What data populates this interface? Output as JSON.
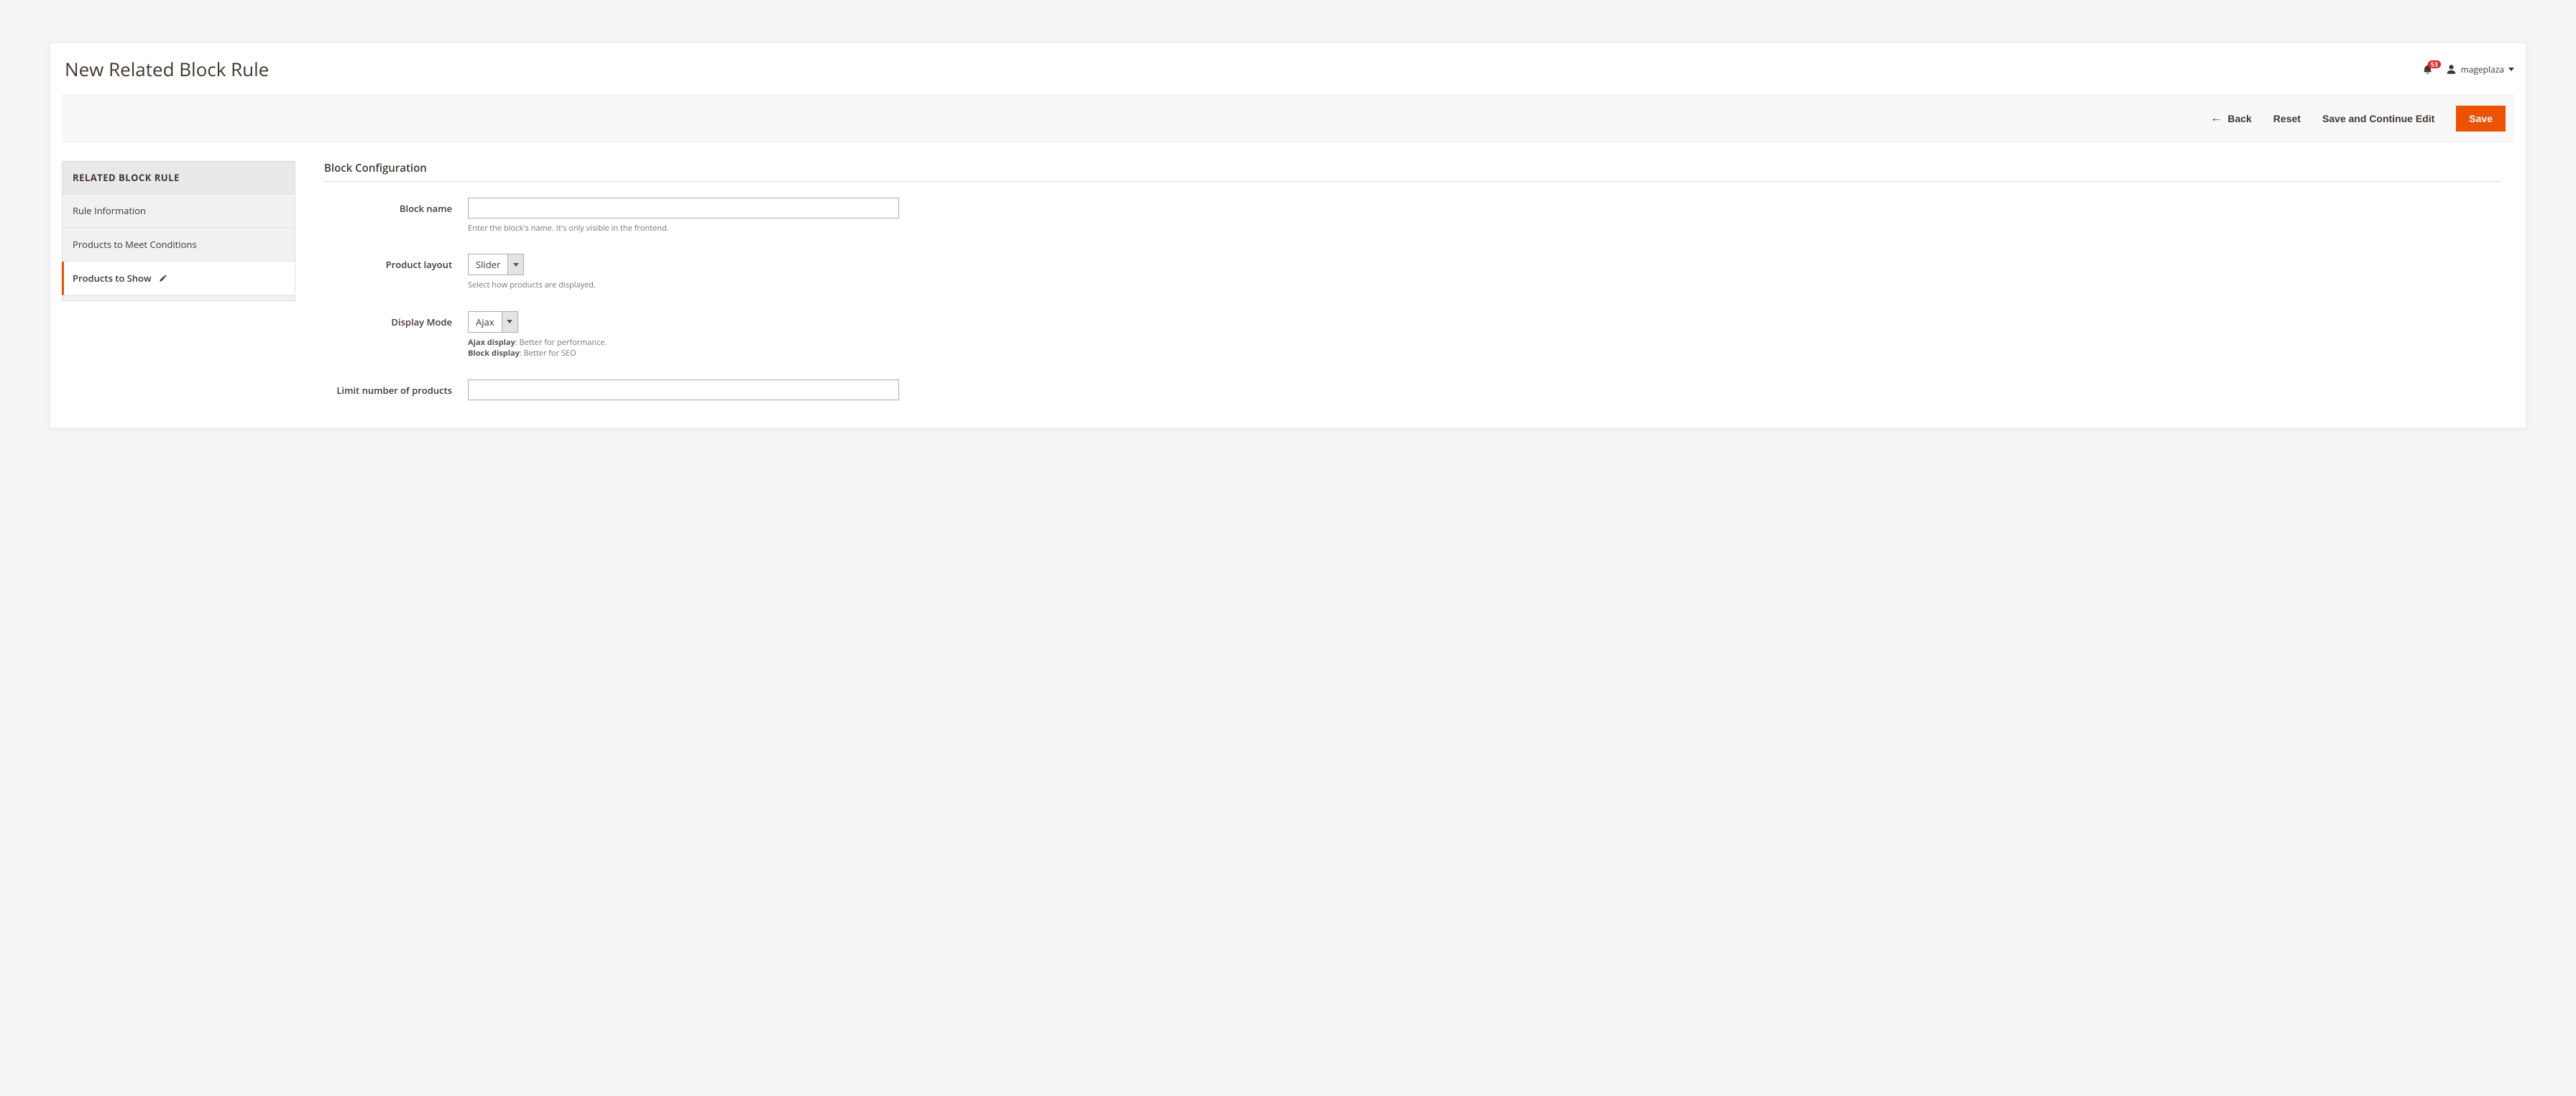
{
  "header": {
    "title": "New Related Block Rule",
    "notification_count": "53",
    "user_name": "mageplaza"
  },
  "actions": {
    "back": "Back",
    "reset": "Reset",
    "save_continue": "Save and Continue Edit",
    "save": "Save"
  },
  "sidebar": {
    "heading": "RELATED BLOCK RULE",
    "items": [
      {
        "label": "Rule Information"
      },
      {
        "label": "Products to Meet Conditions"
      },
      {
        "label": "Products to Show",
        "active": true
      }
    ]
  },
  "form": {
    "section_title": "Block Configuration",
    "block_name": {
      "label": "Block name",
      "value": "",
      "hint": "Enter the block's name. It's only visible in the frontend."
    },
    "product_layout": {
      "label": "Product layout",
      "value": "Slider",
      "hint": "Select how products are displayed."
    },
    "display_mode": {
      "label": "Display Mode",
      "value": "Ajax",
      "hint_ajax_label": "Ajax display",
      "hint_ajax_text": ": Better for performance.",
      "hint_block_label": "Block display",
      "hint_block_text": ": Better for SEO"
    },
    "limit": {
      "label": "Limit number of products",
      "value": ""
    }
  }
}
